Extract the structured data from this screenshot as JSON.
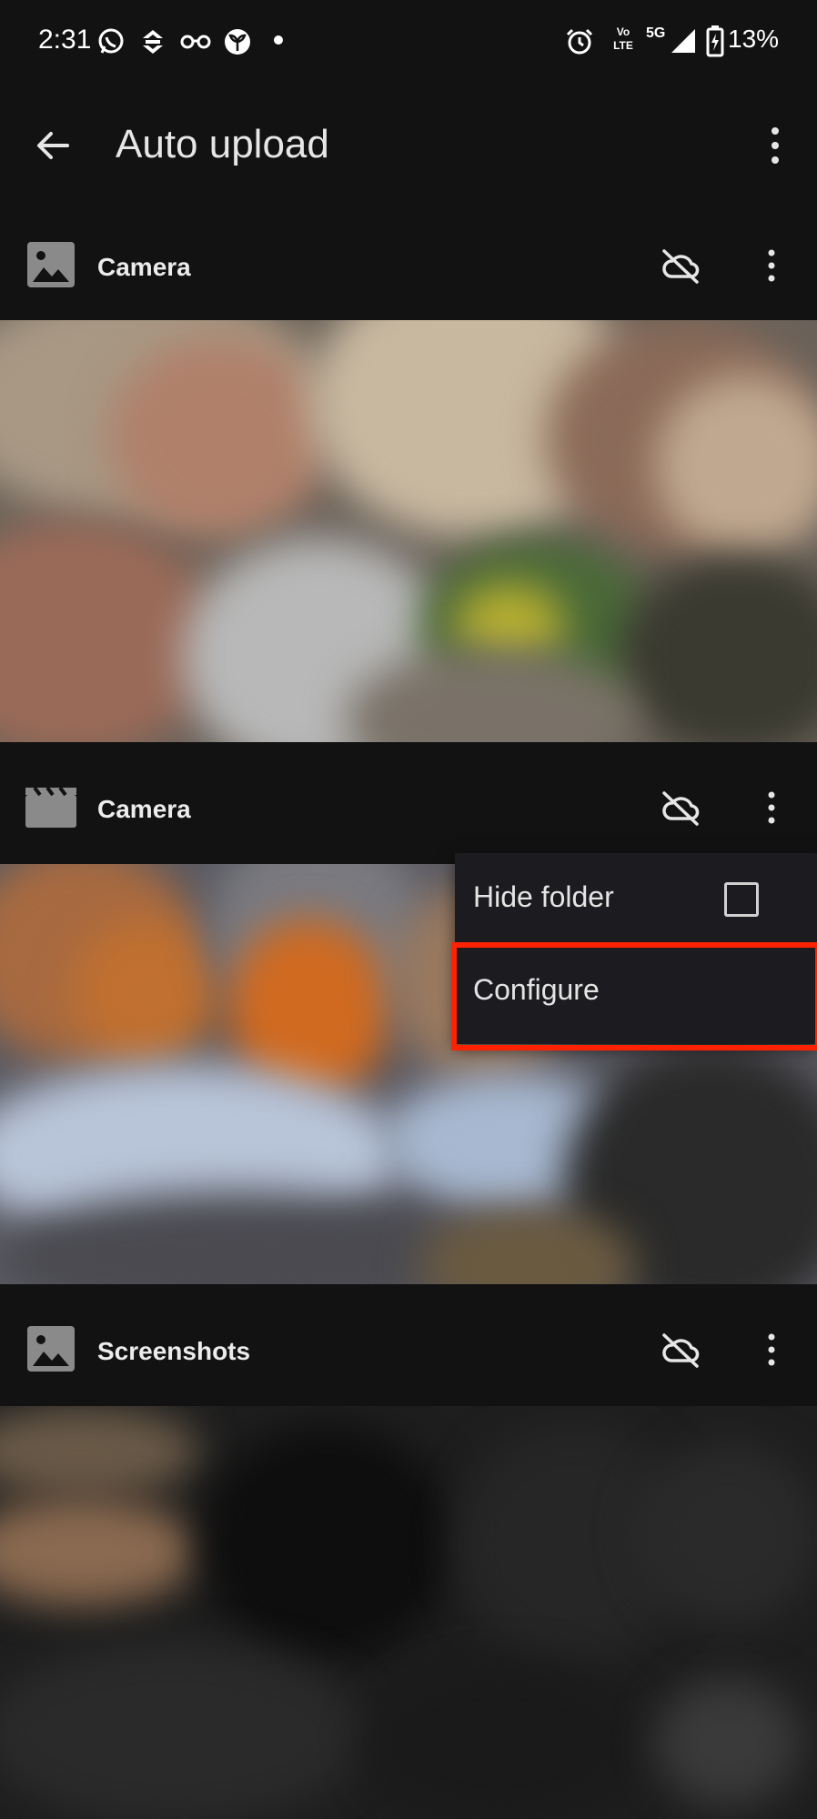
{
  "status_bar": {
    "time": "2:31",
    "network_5g": "5G",
    "volte_top": "Vo",
    "volte_bottom": "LTE",
    "battery": "13%"
  },
  "toolbar": {
    "title": "Auto upload"
  },
  "folders": [
    {
      "title": "Camera",
      "type_icon": "image-icon"
    },
    {
      "title": "Camera",
      "type_icon": "video-icon"
    },
    {
      "title": "Screenshots",
      "type_icon": "image-icon"
    }
  ],
  "menu": {
    "hide_folder": "Hide folder",
    "configure": "Configure"
  },
  "colors": {
    "background": "#121212",
    "highlight": "#ff2200"
  }
}
